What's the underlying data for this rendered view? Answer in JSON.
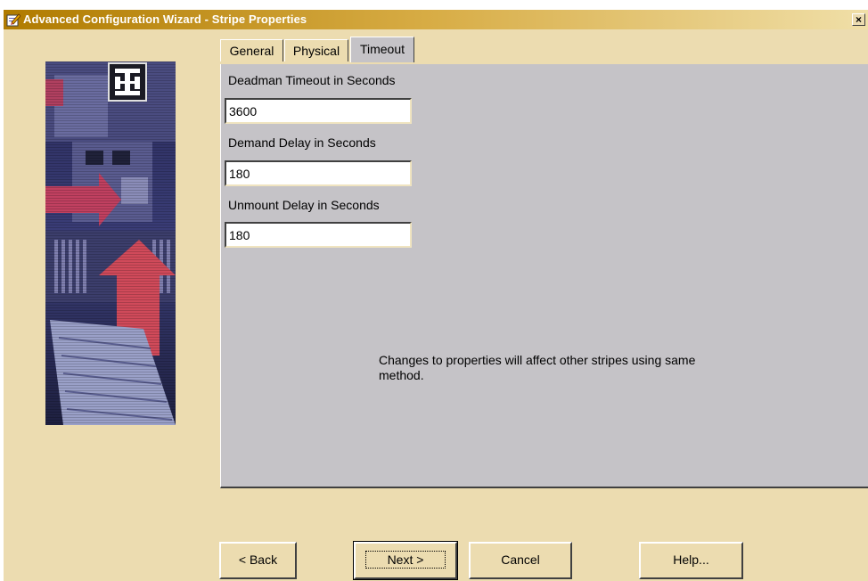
{
  "window": {
    "title": "Advanced Configuration Wizard - Stripe Properties",
    "close_label": "×"
  },
  "tabs": [
    {
      "label": "General",
      "active": false
    },
    {
      "label": "Physical",
      "active": false
    },
    {
      "label": "Timeout",
      "active": true
    }
  ],
  "fields": {
    "deadman": {
      "label": "Deadman Timeout in Seconds",
      "value": "3600"
    },
    "demand": {
      "label": "Demand Delay in Seconds",
      "value": "180"
    },
    "unmount": {
      "label": "Unmount Delay in Seconds",
      "value": "180"
    }
  },
  "notice": "Changes to properties will affect other stripes using same method.",
  "buttons": {
    "back": "< Back",
    "next": "Next >",
    "cancel": "Cancel",
    "help": "Help..."
  },
  "colors": {
    "window_bg": "#ecdcb0",
    "title_gradient_start": "#b07b00",
    "panel_bg": "#c5c3c7"
  },
  "icons": {
    "title": "wizard-pencil-icon",
    "logo": "company-logo-icon"
  }
}
